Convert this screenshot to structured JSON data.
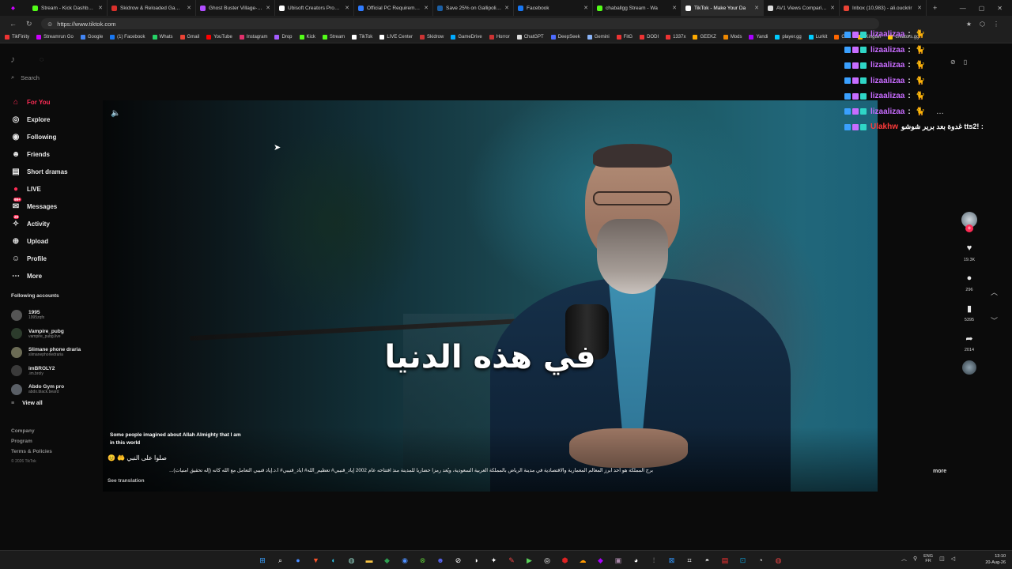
{
  "browser": {
    "tabs": [
      {
        "title": "Stream - Kick Dashboard",
        "color": "#53fc18"
      },
      {
        "title": "Skidrow & Reloaded Games",
        "color": "#d9302b"
      },
      {
        "title": "Ghost Buster Village-P2P -",
        "color": "#b04dff"
      },
      {
        "title": "Ubisoft Creators Program",
        "color": "#ffffff"
      },
      {
        "title": "Official PC Requirements fo",
        "color": "#2f7bff"
      },
      {
        "title": "Save 25% on Gallipoli on St",
        "color": "#1b5fa5"
      },
      {
        "title": "Facebook",
        "color": "#1877f2"
      },
      {
        "title": "chaballgg Stream - Wa",
        "color": "#53fc18"
      },
      {
        "title": "TikTok - Make Your Da",
        "color": "#ffffff",
        "active": true
      },
      {
        "title": "AV1 Views Comparison",
        "color": "#dddddd"
      },
      {
        "title": "Inbox (10,983) - ali.ouckrir",
        "color": "#ea4335"
      }
    ],
    "url": "https://www.tiktok.com",
    "bookmarks": [
      {
        "label": "TikFinity",
        "color": "#e33"
      },
      {
        "label": "Streamrun Go",
        "color": "#c0f"
      },
      {
        "label": "Google",
        "color": "#4285f4"
      },
      {
        "label": "(1) Facebook",
        "color": "#1877f2"
      },
      {
        "label": "Whats",
        "color": "#25d366"
      },
      {
        "label": "Gmail",
        "color": "#ea4335"
      },
      {
        "label": "YouTube",
        "color": "#f00"
      },
      {
        "label": "Instagram",
        "color": "#e1306c"
      },
      {
        "label": "Drop",
        "color": "#a45cff"
      },
      {
        "label": "Kick",
        "color": "#53fc18"
      },
      {
        "label": "Stream",
        "color": "#53fc18"
      },
      {
        "label": "TikTok",
        "color": "#fff"
      },
      {
        "label": "LIVE Center",
        "color": "#fff"
      },
      {
        "label": "Skidrow",
        "color": "#c33"
      },
      {
        "label": "GameDrive",
        "color": "#0af"
      },
      {
        "label": "Horror",
        "color": "#c33"
      },
      {
        "label": "ChatGPT",
        "color": "#ddd"
      },
      {
        "label": "DeepSeek",
        "color": "#4d6bfe"
      },
      {
        "label": "Gemini",
        "color": "#8ab4f8"
      },
      {
        "label": "FitG",
        "color": "#e33"
      },
      {
        "label": "DODI",
        "color": "#e33"
      },
      {
        "label": "1337x",
        "color": "#e33"
      },
      {
        "label": "GEEKZ",
        "color": "#fa0"
      },
      {
        "label": "Mods",
        "color": "#e80"
      },
      {
        "label": "Yandi",
        "color": "#a0f"
      },
      {
        "label": "player.gg",
        "color": "#0cf"
      },
      {
        "label": "Lurkit",
        "color": "#0cf"
      },
      {
        "label": "G2A",
        "color": "#f60"
      },
      {
        "label": "Kinguin",
        "color": "#fb0"
      },
      {
        "label": "creators.gg",
        "color": "#fc0"
      }
    ]
  },
  "sidebar": {
    "search_placeholder": "Search",
    "menu": [
      {
        "label": "For You",
        "icon": "home-icon",
        "glyph": "⌂",
        "active": true
      },
      {
        "label": "Explore",
        "icon": "compass-icon",
        "glyph": "◎"
      },
      {
        "label": "Following",
        "icon": "following-icon",
        "glyph": "◉"
      },
      {
        "label": "Friends",
        "icon": "friends-icon",
        "glyph": "☻"
      },
      {
        "label": "Short dramas",
        "icon": "film-icon",
        "glyph": "▤"
      },
      {
        "label": "LIVE",
        "icon": "live-icon",
        "glyph": "●"
      },
      {
        "label": "Messages",
        "icon": "messages-icon",
        "glyph": "✉",
        "badge": "99+"
      },
      {
        "label": "Activity",
        "icon": "activity-icon",
        "glyph": "✧",
        "badge": "29"
      },
      {
        "label": "Upload",
        "icon": "upload-icon",
        "glyph": "⊕"
      },
      {
        "label": "Profile",
        "icon": "profile-icon",
        "glyph": "☺"
      },
      {
        "label": "More",
        "icon": "more-icon",
        "glyph": "⋯"
      }
    ],
    "following_heading": "Following accounts",
    "accounts": [
      {
        "name": "1995",
        "username": "1995zqfx"
      },
      {
        "name": "Vampire_pubg",
        "username": "vampire_pubg.live"
      },
      {
        "name": "Slimane phone draria",
        "username": "slimanephonedraria"
      },
      {
        "name": "imBROLY2",
        "username": ".im.broly"
      },
      {
        "name": "Abdo Gym pro",
        "username": "abdo.black.beard"
      }
    ],
    "view_all": "View all",
    "footer": [
      "Company",
      "Program",
      "Terms & Policies"
    ],
    "copyright": "© 2026 TikTok"
  },
  "video": {
    "caption": "في هذه الدنيا",
    "description": "Some people imagined about Allah Almighty that I am in this world",
    "hashtag_line": "صلوا على النبي 🤲 😊",
    "description_ar": "برج المملكة هو أحد أبرز المعالم المعمارية والاقتصادية في مدينة الرياض بالمملكة العربية السعودية، ويُعد رمزاً حضارياً للمدينة منذ افتتاحه عام 2002 إياد_قنيبي# تعظيم_الله# اياد_قنيبي# أ.د.إياد قنيبي التعامل مع الله كأنه (إله تحقيق امنيات)...",
    "see_translation": "See translation",
    "more": "more"
  },
  "actions": {
    "likes": "19.3K",
    "comments": "296",
    "saves": "5395",
    "shares": "2014"
  },
  "chat": [
    {
      "user": "lizaalizaa",
      "message": ":"
    },
    {
      "user": "lizaalizaa",
      "message": ":"
    },
    {
      "user": "lizaalizaa",
      "message": ":"
    },
    {
      "user": "lizaalizaa",
      "message": ":"
    },
    {
      "user": "lizaalizaa",
      "message": ":"
    },
    {
      "user": "lizaalizaa",
      "message": ":"
    },
    {
      "user": "Ulakhw",
      "message": ": !tts2 غدوة بعد برير شوشو"
    }
  ],
  "taskbar": {
    "language_top": "ENG",
    "language_bottom": "FR",
    "time": "13:10",
    "date": "20-Aug-26"
  }
}
